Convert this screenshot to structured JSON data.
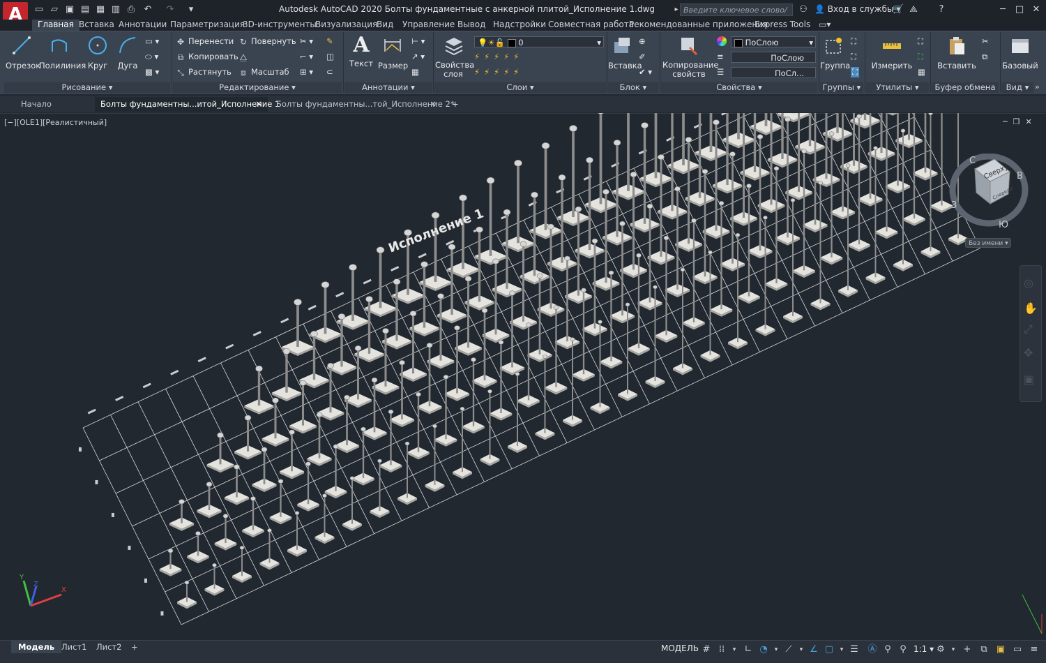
{
  "app": {
    "logo": "A",
    "title": "Autodesk AutoCAD 2020   Болты фундаментные с анкерной плитой_Исполнение 1.dwg",
    "search_placeholder": "Введите ключевое слово/фразу",
    "signin": "Вход в службы",
    "accent_color": "#c4262e"
  },
  "ribbon": {
    "tabs": [
      "Главная",
      "Вставка",
      "Аннотации",
      "Параметризация",
      "3D-инструменты",
      "Визуализация",
      "Вид",
      "Управление",
      "Вывод",
      "Надстройки",
      "Совместная работа",
      "Рекомендованные приложения",
      "Express Tools"
    ],
    "draw": {
      "line": "Отрезок",
      "polyline": "Полилиния",
      "circle": "Круг",
      "arc": "Дуга",
      "title": "Рисование"
    },
    "modify": {
      "move": "Перенести",
      "rotate": "Повернуть",
      "copy": "Копировать",
      "stretch": "Растянуть",
      "scale": "Масштаб",
      "title": "Редактирование"
    },
    "annotation": {
      "text": "Текст",
      "dimension": "Размер",
      "title": "Аннотации"
    },
    "layers": {
      "props": "Свойства слоя",
      "current_layer": "0",
      "title": "Слои"
    },
    "block": {
      "insert": "Вставка",
      "title": "Блок"
    },
    "properties": {
      "match": "Копирование свойств",
      "color": "ПоСлою",
      "linetype": "ПоСлою",
      "lineweight": "ПоСл...",
      "title": "Свойства"
    },
    "groups": {
      "group": "Группа",
      "title": "Группы"
    },
    "utilities": {
      "measure": "Измерить",
      "title": "Утилиты"
    },
    "clipboard": {
      "paste": "Вставить",
      "title": "Буфер обмена"
    },
    "view": {
      "base": "Базовый",
      "title": "Вид"
    }
  },
  "filetabs": {
    "start": "Начало",
    "tab1": "Болты фундаментны...итой_Исполнение 1",
    "tab2": "Болты фундаментны...той_Исполнение 2*"
  },
  "viewport": {
    "label": "[−][OLE1][Реалистичный]",
    "drawing_title": "Исполнение 1",
    "viewcube_top": "Сверху",
    "viewcube_front": "Спереди",
    "compass": {
      "north": "С",
      "south": "Ю",
      "east": "В",
      "west": "З"
    },
    "ucs_name": "Без имени"
  },
  "statusbar": {
    "layout_tabs": [
      "Модель",
      "Лист1",
      "Лист2"
    ],
    "model": "МОДЕЛЬ",
    "scale": "1:1"
  }
}
